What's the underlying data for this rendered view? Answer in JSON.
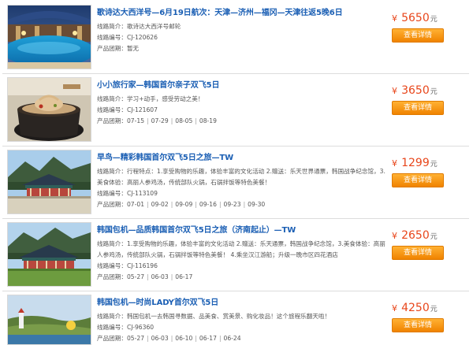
{
  "labels": {
    "intro": "线路简介：",
    "code": "线路编号：",
    "dates": "产品团期："
  },
  "tours": [
    {
      "title": "歌诗达大西洋号—6月19日航次：天津—济州—福冈—天津往返5晚6日",
      "intro": "歌诗达大西洋号邮轮",
      "code": "CJ-120626",
      "dates": [
        "暂无"
      ],
      "currency": "¥",
      "price": "5650",
      "unit": "元",
      "button": "查看详情",
      "image": "cruise-pool"
    },
    {
      "title": "小小旅行家—韩国首尔亲子双飞5日",
      "intro": "学习+动手，感受劳动之美！",
      "code": "CJ-121607",
      "dates": [
        "07-15",
        "07-29",
        "08-05",
        "08-19"
      ],
      "currency": "¥",
      "price": "3650",
      "unit": "元",
      "button": "查看详情",
      "image": "ginseng-chicken-soup"
    },
    {
      "title": "早鸟—精彩韩国首尔双飞5日之旅—TW",
      "intro": "行程特点：1.享受购物的乐趣，体验丰富的文化活动 2.赠送：乐天世界通票，韩国战争纪念馆，3.美食体验：高丽人参鸡汤，传统部队火锅，石锅拌饭等特色美餐！",
      "code": "CJ-113109",
      "dates": [
        "07-01",
        "09-02",
        "09-09",
        "09-16",
        "09-23",
        "09-30"
      ],
      "currency": "¥",
      "price": "1299",
      "unit": "元",
      "button": "查看详情",
      "image": "korean-palace"
    },
    {
      "title": "韩国包机—品质韩国首尔双飞5日之旅（济南起止）—TW",
      "intro": "1.享受购物的乐趣，体验丰富的文化活动 2.赠送：乐天通票，韩国战争纪念馆，3.美食体验：高丽人参鸡汤，传统部队火锅，石锅拌饭等特色美餐！ 4.乘坐汉江游船；升级一晚市区四花酒店",
      "code": "CJ-116196",
      "dates": [
        "05-27",
        "06-03",
        "06-17"
      ],
      "currency": "¥",
      "price": "2650",
      "unit": "元",
      "button": "查看详情",
      "image": "korean-palace"
    },
    {
      "title": "韩国包机—时尚LADY首尔双飞5日",
      "intro": "韩国包机一去韩国寻数据、品美食、赏美景、购化妆品！这个旅程乐翻天啦！",
      "code": "CJ-96360",
      "dates": [
        "05-27",
        "06-03",
        "06-10",
        "06-17",
        "06-24"
      ],
      "currency": "¥",
      "price": "4250",
      "unit": "元",
      "button": "查看详情",
      "image": "coastal-lighthouse"
    }
  ]
}
